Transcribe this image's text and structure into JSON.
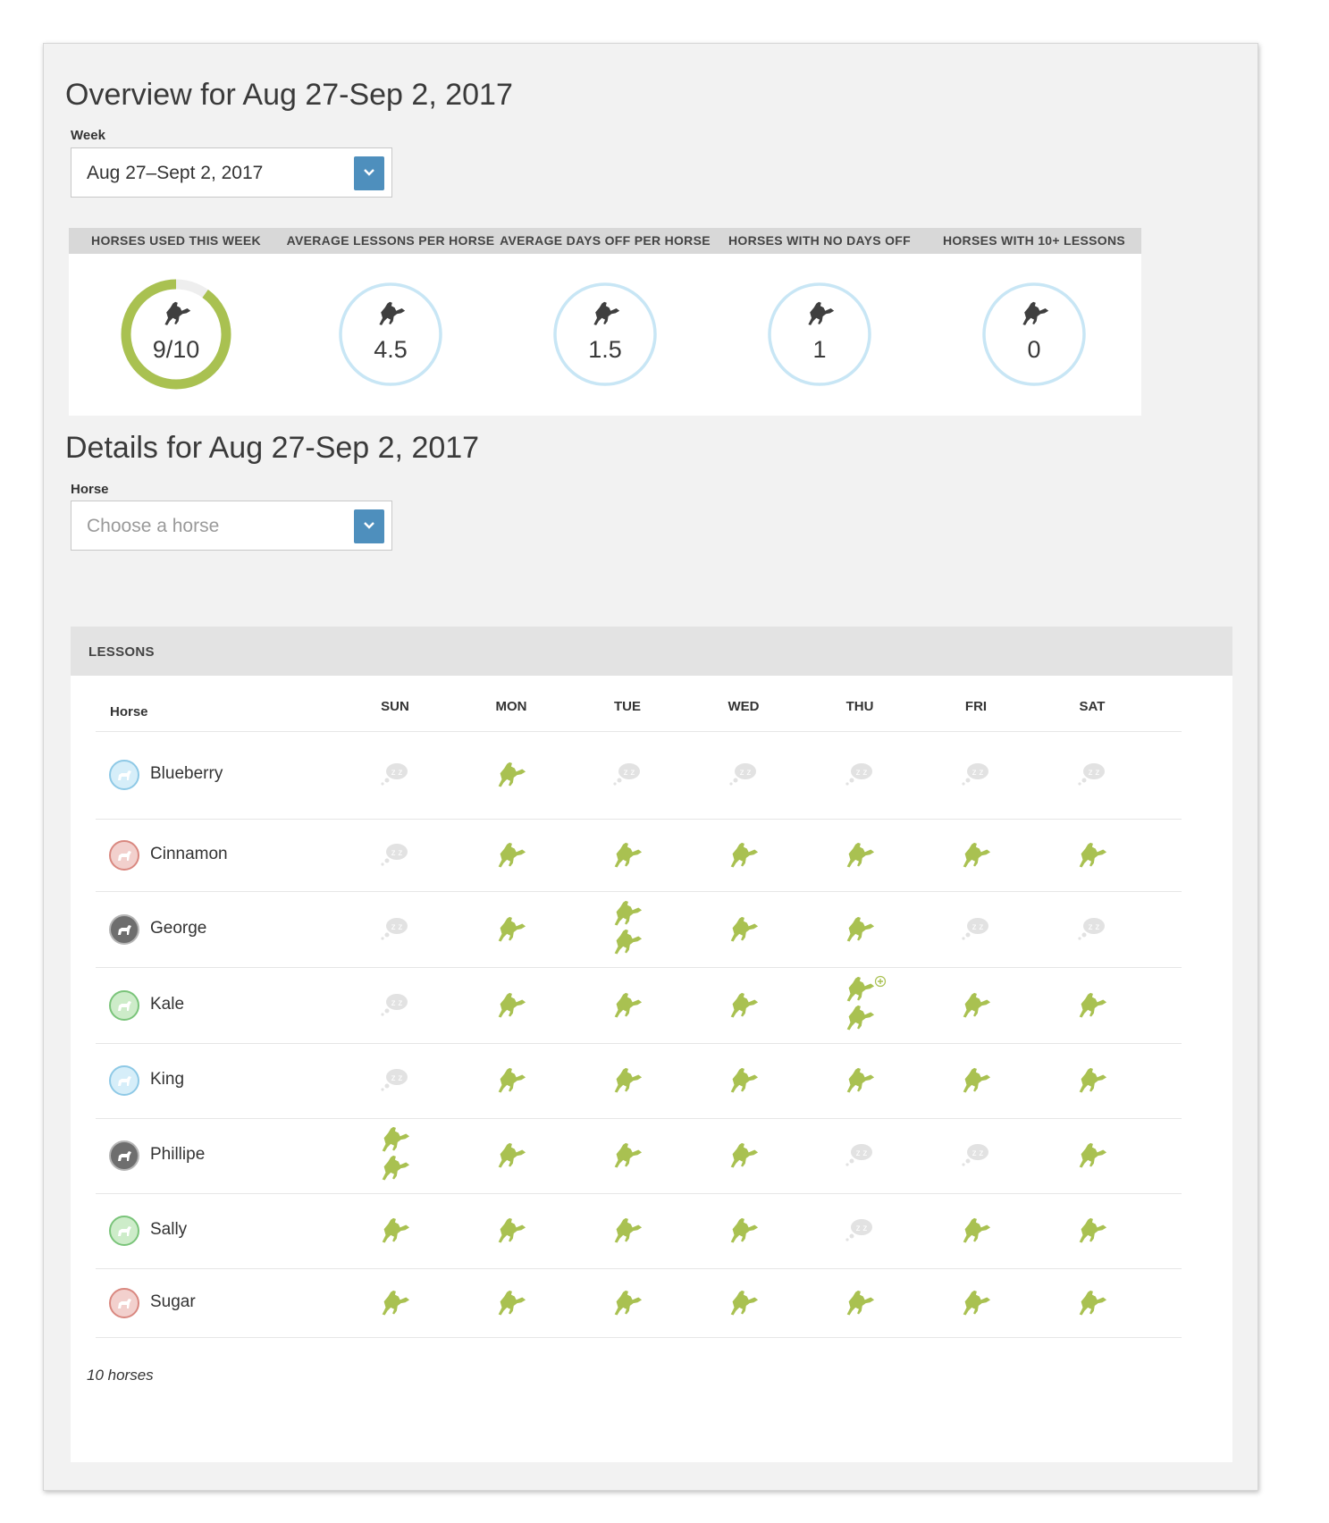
{
  "overview": {
    "title": "Overview for Aug 27-Sep 2, 2017",
    "week_label": "Week",
    "week_value": "Aug 27–Sept 2, 2017"
  },
  "stats": [
    {
      "caption": "HORSES USED THIS WEEK",
      "value": "9/10",
      "progress": 0.9
    },
    {
      "caption": "AVERAGE LESSONS PER HORSE",
      "value": "4.5"
    },
    {
      "caption": "AVERAGE DAYS OFF PER HORSE",
      "value": "1.5"
    },
    {
      "caption": "HORSES WITH NO DAYS OFF",
      "value": "1"
    },
    {
      "caption": "HORSES WITH 10+ LESSONS",
      "value": "0"
    }
  ],
  "details": {
    "title": "Details for Aug 27-Sep 2, 2017",
    "horse_label": "Horse",
    "horse_placeholder": "Choose a horse"
  },
  "lessons": {
    "title": "LESSONS",
    "horse_col": "Horse",
    "days": [
      "SUN",
      "MON",
      "TUE",
      "WED",
      "THU",
      "FRI",
      "SAT"
    ],
    "rows": [
      {
        "name": "Blueberry",
        "avatar": "blue",
        "cells": [
          0,
          1,
          0,
          0,
          0,
          0,
          0
        ]
      },
      {
        "name": "Cinnamon",
        "avatar": "red",
        "cells": [
          0,
          1,
          1,
          1,
          1,
          1,
          1
        ]
      },
      {
        "name": "George",
        "avatar": "photo",
        "cells": [
          0,
          1,
          2,
          1,
          1,
          0,
          0
        ]
      },
      {
        "name": "Kale",
        "avatar": "green",
        "cells": [
          0,
          1,
          1,
          1,
          2,
          1,
          1
        ],
        "plus": [
          4
        ]
      },
      {
        "name": "King",
        "avatar": "blue",
        "cells": [
          0,
          1,
          1,
          1,
          1,
          1,
          1
        ]
      },
      {
        "name": "Phillipe",
        "avatar": "photo",
        "cells": [
          2,
          1,
          1,
          1,
          0,
          0,
          1
        ]
      },
      {
        "name": "Sally",
        "avatar": "green",
        "cells": [
          1,
          1,
          1,
          1,
          0,
          1,
          1
        ]
      },
      {
        "name": "Sugar",
        "avatar": "red",
        "cells": [
          1,
          1,
          1,
          1,
          1,
          1,
          1
        ]
      }
    ],
    "footer": "10 horses"
  },
  "colors": {
    "ring_progress": "#a9c151",
    "ring_light": "#c8e6f5",
    "lesson_icon": "#a9c151",
    "rest_icon": "#e2e2e2",
    "dropdown_button": "#4e8fbd"
  }
}
